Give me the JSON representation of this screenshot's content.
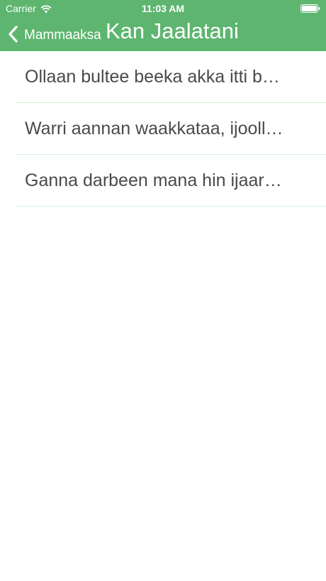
{
  "status_bar": {
    "carrier": "Carrier",
    "time": "11:03 AM",
    "wifi_icon": "wifi-icon",
    "battery_icon": "battery-icon"
  },
  "nav": {
    "back_label": "Mammaaksa",
    "title": "Kan Jaalatani",
    "back_icon": "chevron-left-icon",
    "bar_color": "#5eb56f"
  },
  "list": {
    "items": [
      {
        "label": "Ollaan bultee beeka akka itti b…"
      },
      {
        "label": "Warri aannan waakkataa, ijooll…"
      },
      {
        "label": "Ganna darbeen mana hin ijaar…"
      }
    ],
    "separator_color": "#d8efd6",
    "text_color": "#4a4a4a"
  }
}
